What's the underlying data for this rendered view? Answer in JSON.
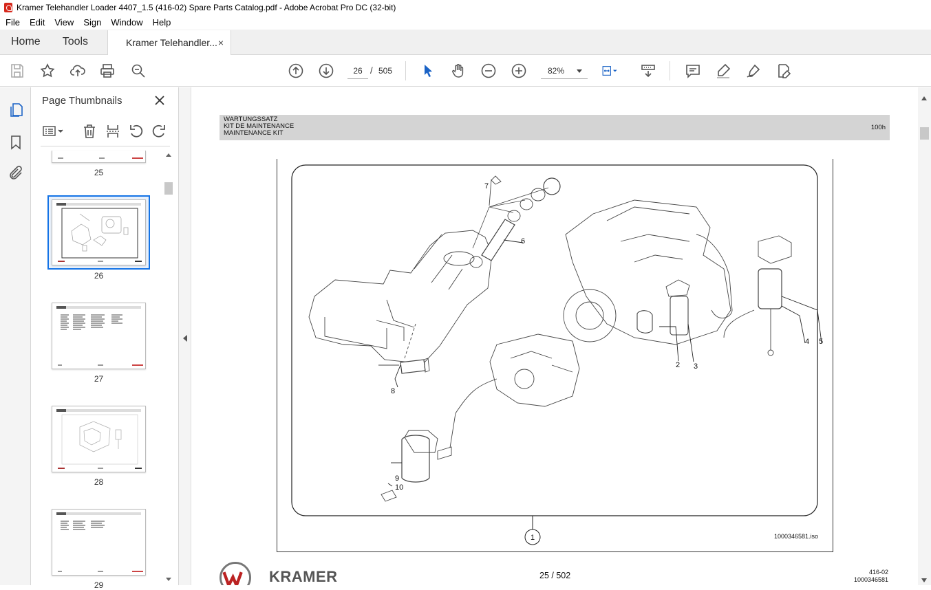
{
  "window": {
    "title": "Kramer Telehandler Loader 4407_1.5 (416-02) Spare Parts Catalog.pdf - Adobe Acrobat Pro DC (32-bit)"
  },
  "menu": [
    "File",
    "Edit",
    "View",
    "Sign",
    "Window",
    "Help"
  ],
  "tabs": {
    "home": "Home",
    "tools": "Tools",
    "document": "Kramer Telehandler...",
    "close": "×"
  },
  "toolbar": {
    "current_page": "26",
    "page_sep": "/",
    "total_pages": "505",
    "zoom": "82%"
  },
  "sidebar": {
    "title": "Page Thumbnails",
    "close": "×",
    "thumbnails": [
      {
        "label": "25"
      },
      {
        "label": "26",
        "selected": true
      },
      {
        "label": "27"
      },
      {
        "label": "28"
      },
      {
        "label": "29"
      }
    ]
  },
  "document": {
    "header_lines": [
      "WARTUNGSSATZ",
      "KIT DE MAINTENANCE",
      "MAINTENANCE KIT"
    ],
    "header_right": "100h",
    "callouts": [
      "1",
      "2",
      "3",
      "4",
      "5",
      "6",
      "7",
      "8",
      "9",
      "10"
    ],
    "figure_id": "1000346581.iso",
    "page_count": "25 / 502",
    "footer_code_1": "416-02",
    "footer_code_2": "1000346581",
    "brand": "KRAMER"
  },
  "colors": {
    "accent": "#1473e6",
    "header_gray": "#d4d4d4",
    "acrobat_red": "#d6281c"
  }
}
